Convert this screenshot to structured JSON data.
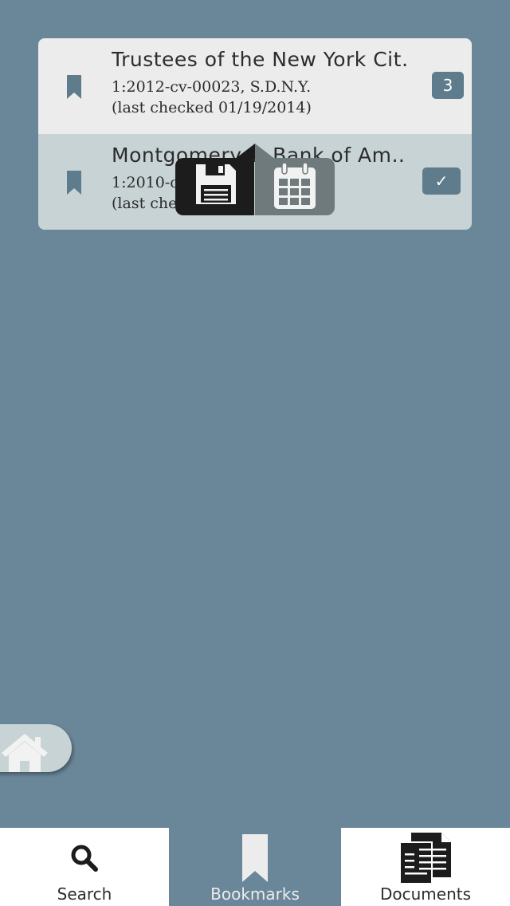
{
  "bookmarks": [
    {
      "title": "Trustees of the New York Cit…",
      "case_number": "1:2012-cv-00023, S.D.N.Y.",
      "last_checked": "(last checked 01/19/2014)",
      "badge": "3"
    },
    {
      "title": "Montgomery v. Bank of Am…",
      "case_number": "1:2010-cv",
      "last_checked": "(last che",
      "badge": "✓"
    }
  ],
  "popup": {
    "left_icon": "floppy-disk-icon",
    "right_icon": "calendar-icon"
  },
  "home_icon": "home-icon",
  "tabs": [
    {
      "label": "Search",
      "icon": "search-icon"
    },
    {
      "label": "Bookmarks",
      "icon": "bookmark-icon"
    },
    {
      "label": "Documents",
      "icon": "documents-icon"
    }
  ],
  "colors": {
    "background": "#6a8799",
    "row_light": "#ececec",
    "row_selected": "#c8d3d6",
    "badge": "#5e7c8c"
  }
}
